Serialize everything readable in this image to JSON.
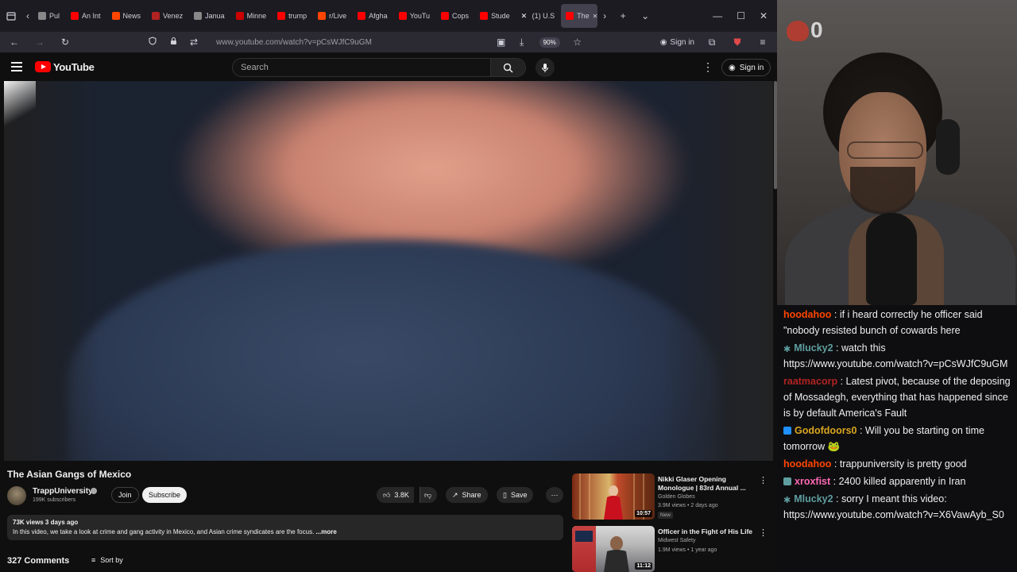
{
  "colors": {
    "youtube_red": "#ff0000",
    "chat_bg": "#0e0e10",
    "user_hoodahoo": "#ff4500",
    "user_mlucky2": "#5f9ea0",
    "user_raatmacorp": "#b22222",
    "user_godofdoors0": "#daa520",
    "user_xroxfist": "#ff69b4"
  },
  "browser": {
    "tabs": [
      {
        "label": "Pul",
        "icon": "pin-icon",
        "color": "#888"
      },
      {
        "label": "An Int",
        "icon": "youtube-icon",
        "color": "#ff0000"
      },
      {
        "label": "News",
        "icon": "reddit-icon",
        "color": "#ff4500"
      },
      {
        "label": "Venez",
        "icon": "circle-icon",
        "color": "#b22222"
      },
      {
        "label": "Janua",
        "icon": "bank-icon",
        "color": "#888"
      },
      {
        "label": "Minne",
        "icon": "cnn-icon",
        "color": "#cc0000"
      },
      {
        "label": "trump",
        "icon": "youtube-icon",
        "color": "#ff0000"
      },
      {
        "label": "r/Live",
        "icon": "reddit-icon",
        "color": "#ff4500"
      },
      {
        "label": "Afgha",
        "icon": "youtube-icon",
        "color": "#ff0000"
      },
      {
        "label": "YouTu",
        "icon": "youtube-icon",
        "color": "#ff0000"
      },
      {
        "label": "Cops",
        "icon": "youtube-icon",
        "color": "#ff0000"
      },
      {
        "label": "Stude",
        "icon": "youtube-icon",
        "color": "#ff0000"
      },
      {
        "label": "(1) U.S",
        "icon": "x-icon",
        "color": "#ffffff"
      },
      {
        "label": "The",
        "icon": "youtube-icon",
        "color": "#ff0000",
        "active": true
      }
    ],
    "url": "www.youtube.com/watch?v=pCsWJfC9uGM",
    "zoom": "90%",
    "sign_in": "Sign in"
  },
  "youtube": {
    "logo_text": "YouTube",
    "search_placeholder": "Search",
    "sign_in": "Sign in"
  },
  "video": {
    "title": "The Asian Gangs of Mexico",
    "channel": "TrappUniversity",
    "subscribers": "199K subscribers",
    "join": "Join",
    "subscribe": "Subscribe",
    "likes": "3.8K",
    "share": "Share",
    "save": "Save",
    "meta": "73K views  3 days ago",
    "description": "In this video, we take a look at crime and gang activity in Mexico, and Asian crime syndicates are the focus.",
    "more": " ...more",
    "comments": "327 Comments",
    "sort_by": "Sort by"
  },
  "recommended": [
    {
      "title": "Nikki Glaser Opening Monologue | 83rd Annual ...",
      "channel": "Golden Globes",
      "views": "3.9M views • 2 days ago",
      "badge": "New",
      "duration": "10:57"
    },
    {
      "title": "Officer in the Fight of His Life",
      "channel": "Midwest Safety",
      "views": "1.9M views • 1 year ago",
      "duration": "11:12"
    }
  ],
  "stream": {
    "logo_glyph": "0"
  },
  "chat": [
    {
      "user": "hoodahoo",
      "color_key": "user_hoodahoo",
      "badge": "",
      "text": "if i heard correctly he officer said \"nobody resisted bunch of cowards here"
    },
    {
      "user": "Mlucky2",
      "color_key": "user_mlucky2",
      "badge": "gear",
      "text": "watch this https://www.youtube.com/watch?v=pCsWJfC9uGM"
    },
    {
      "user": "raatmacorp",
      "color_key": "user_raatmacorp",
      "badge": "",
      "text": "Latest pivot, because of the deposing of Mossadegh, everything that has happened since is by default America's Fault"
    },
    {
      "user": "Godofdoors0",
      "color_key": "user_godofdoors0",
      "badge": "prime",
      "text": "Will you be starting on time tomorrow 🐸"
    },
    {
      "user": "hoodahoo",
      "color_key": "user_hoodahoo",
      "badge": "",
      "text": "trappuniversity is pretty good"
    },
    {
      "user": "xroxfist",
      "color_key": "user_xroxfist",
      "badge": "sub",
      "text": "2400 killed apparently in Iran"
    },
    {
      "user": "Mlucky2",
      "color_key": "user_mlucky2",
      "badge": "gear",
      "text": "sorry I meant this video: https://www.youtube.com/watch?v=X6VawAyb_S0"
    }
  ]
}
